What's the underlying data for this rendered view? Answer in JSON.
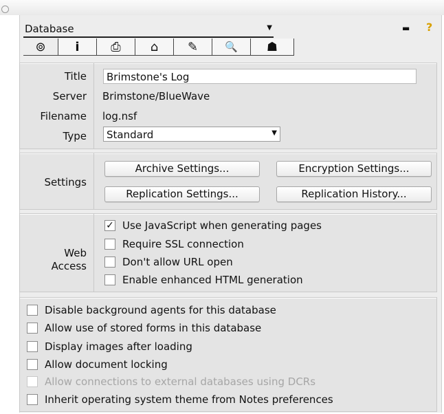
{
  "window": {},
  "header": {
    "dropdown_label": "Database",
    "key_icon": "key-icon",
    "help_icon": "help-icon"
  },
  "tabs": [
    {
      "icon": "info-icon",
      "glyph": "⊚"
    },
    {
      "icon": "information-i-icon",
      "glyph": "i"
    },
    {
      "icon": "printer-icon",
      "glyph": "⎙"
    },
    {
      "icon": "design-icon",
      "glyph": "⌂"
    },
    {
      "icon": "launch-rocket-icon",
      "glyph": "✎"
    },
    {
      "icon": "search-magnifier-icon",
      "glyph": "🔍"
    },
    {
      "icon": "advanced-hat-icon",
      "glyph": "☗"
    }
  ],
  "basics": {
    "title_label": "Title",
    "title_value": "Brimstone's Log",
    "server_label": "Server",
    "server_value": "Brimstone/BlueWave",
    "filename_label": "Filename",
    "filename_value": "log.nsf",
    "type_label": "Type",
    "type_value": "Standard"
  },
  "settings": {
    "label": "Settings",
    "archive_btn": "Archive Settings...",
    "encryption_btn": "Encryption Settings...",
    "replication_btn": "Replication Settings...",
    "history_btn": "Replication History..."
  },
  "web_access": {
    "label_line1": "Web",
    "label_line2": "Access",
    "options": [
      {
        "label": "Use JavaScript when generating pages",
        "checked": true
      },
      {
        "label": "Require SSL connection",
        "checked": false
      },
      {
        "label": "Don't allow URL open",
        "checked": false
      },
      {
        "label": "Enable enhanced HTML generation",
        "checked": false
      }
    ]
  },
  "options": [
    {
      "label": "Disable background agents for this database",
      "checked": false,
      "disabled": false
    },
    {
      "label": "Allow use of stored forms in this database",
      "checked": false,
      "disabled": false
    },
    {
      "label": "Display images after loading",
      "checked": false,
      "disabled": false
    },
    {
      "label": "Allow document locking",
      "checked": false,
      "disabled": false
    },
    {
      "label": "Allow connections to external databases using DCRs",
      "checked": false,
      "disabled": true
    },
    {
      "label": "Inherit operating system theme from Notes preferences",
      "checked": false,
      "disabled": false
    }
  ],
  "check_mark": "✓"
}
